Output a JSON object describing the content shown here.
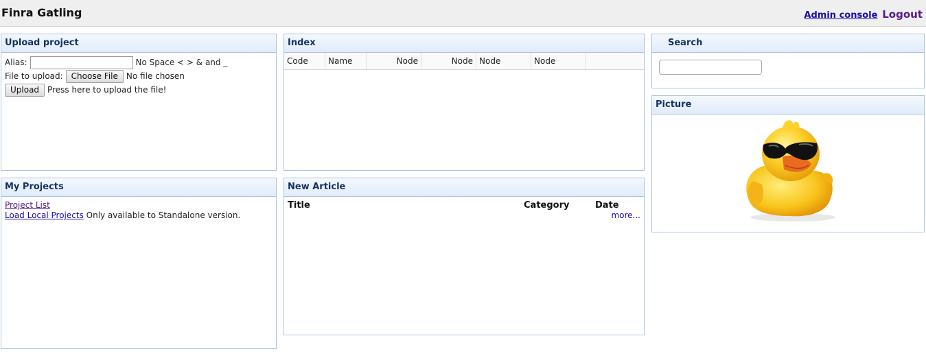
{
  "app": {
    "title": "Finra Gatling",
    "admin_console": "Admin console",
    "logout": "Logout"
  },
  "upload": {
    "title": "Upload project",
    "alias_label": "Alias:",
    "alias_value": "",
    "alias_hint": "No Space < > & and _",
    "file_label": "File to upload:",
    "choose_file": "Choose File",
    "no_file": "No file chosen",
    "upload_button": "Upload",
    "upload_hint": "Press here to upload the file!"
  },
  "index": {
    "title": "Index",
    "columns": [
      "Code",
      "Name",
      "Node",
      "Node",
      "Node",
      "Node"
    ],
    "rows": []
  },
  "search": {
    "title": "Search",
    "value": ""
  },
  "picture": {
    "title": "Picture",
    "image": "rubber-duck-with-sunglasses"
  },
  "projects": {
    "title": "My Projects",
    "project_list": "Project List",
    "load_local": "Load Local Projects",
    "load_local_note": "Only available to Standalone version."
  },
  "article": {
    "title": "New Article",
    "columns": [
      "Title",
      "Category",
      "Date"
    ],
    "more": "more..."
  },
  "colors": {
    "panel_border": "#a9c2e0",
    "header_text": "#15325e",
    "link": "#1a0dab",
    "visited_link": "#551a8b"
  }
}
